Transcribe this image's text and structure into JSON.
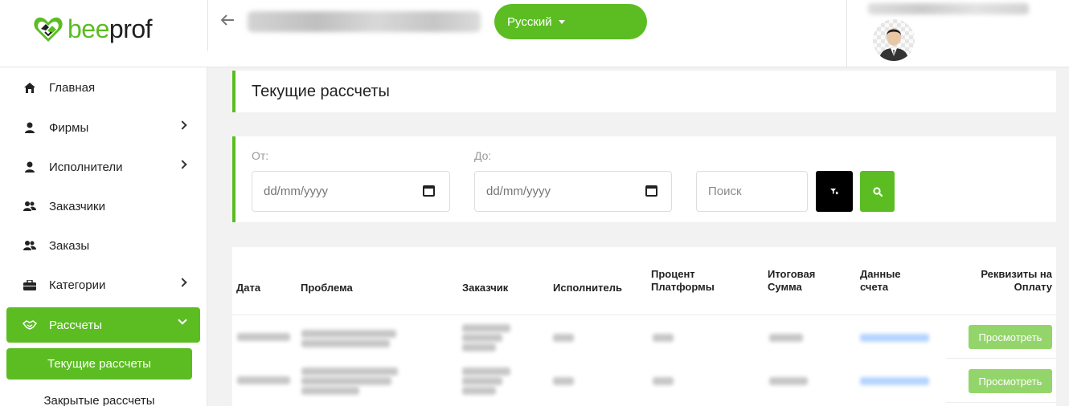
{
  "brand": {
    "name_part1": "bee",
    "name_part2": "prof",
    "accent": "#5bbd22"
  },
  "header": {
    "language": "Русский"
  },
  "sidebar": {
    "items": [
      {
        "label": "Главная",
        "icon": "home-icon",
        "chevron": false
      },
      {
        "label": "Фирмы",
        "icon": "user-icon",
        "chevron": true
      },
      {
        "label": "Исполнители",
        "icon": "user-icon",
        "chevron": true
      },
      {
        "label": "Заказчики",
        "icon": "users-icon",
        "chevron": false
      },
      {
        "label": "Заказы",
        "icon": "users-icon",
        "chevron": false
      },
      {
        "label": "Категории",
        "icon": "briefcase-icon",
        "chevron": true
      },
      {
        "label": "Рассчеты",
        "icon": "handshake-icon",
        "chevron": true,
        "active": true
      }
    ],
    "subitems": [
      {
        "label": "Текущие рассчеты",
        "active": true
      },
      {
        "label": "Закрытые рассчеты"
      }
    ]
  },
  "main": {
    "title": "Текущие рассчеты",
    "filters": {
      "from_label": "От:",
      "to_label": "До:",
      "date_placeholder": "dd/mm/yyyy",
      "search_placeholder": "Поиск"
    },
    "table": {
      "columns": [
        "Дата",
        "Проблема",
        "Заказчик",
        "Исполнитель",
        "Процент Платформы",
        "Итоговая Сумма",
        "Данные счета",
        "Реквизиты на Оплату"
      ],
      "col_lines": [
        [
          "Дата"
        ],
        [
          "Проблема"
        ],
        [
          "Заказчик"
        ],
        [
          "Исполнитель"
        ],
        [
          "Процент",
          "Платформы"
        ],
        [
          "Итоговая",
          "Сумма"
        ],
        [
          "Данные",
          "счета"
        ],
        [
          "Реквизиты на",
          "Оплату"
        ]
      ],
      "row_action": "Просмотреть",
      "rows": 2
    }
  }
}
